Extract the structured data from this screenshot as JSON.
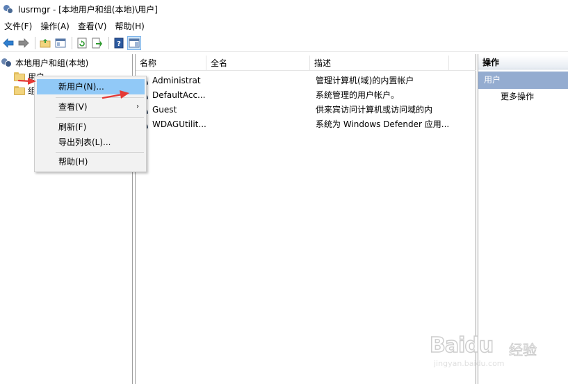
{
  "window": {
    "title": "lusrmgr - [本地用户和组(本地)\\用户]"
  },
  "menubar": {
    "items": [
      "文件(F)",
      "操作(A)",
      "查看(V)",
      "帮助(H)"
    ]
  },
  "toolbar": {
    "icons": [
      "back-arrow-icon",
      "forward-arrow-icon",
      "up-folder-icon",
      "show-hide-tree-icon",
      "refresh-icon",
      "export-list-icon",
      "help-icon",
      "show-hide-action-pane-icon"
    ]
  },
  "tree": {
    "root": "本地用户和组(本地)",
    "items": [
      "用户",
      "组"
    ]
  },
  "list": {
    "columns": [
      "名称",
      "全名",
      "描述"
    ],
    "rows": [
      {
        "name": "Administrat",
        "fullname": "",
        "desc": "管理计算机(域)的内置帐户"
      },
      {
        "name": "DefaultAcc...",
        "fullname": "",
        "desc": "系统管理的用户帐户。"
      },
      {
        "name": "Guest",
        "fullname": "",
        "desc": "供来宾访问计算机或访问域的内"
      },
      {
        "name": "WDAGUtilit...",
        "fullname": "",
        "desc": "系统为 Windows Defender 应用..."
      }
    ]
  },
  "actions": {
    "header": "操作",
    "section": "用户",
    "more": "更多操作"
  },
  "context_menu": {
    "items": [
      {
        "label": "新用户(N)...",
        "highlighted": true
      },
      {
        "label": "查看(V)",
        "submenu": true
      },
      {
        "label": "刷新(F)"
      },
      {
        "label": "导出列表(L)..."
      },
      {
        "label": "帮助(H)"
      }
    ],
    "submenu_glyph": "›"
  },
  "watermark": {
    "brand": "Baidu",
    "cn": "经验",
    "url": "jingyan.baidu.com"
  },
  "colors": {
    "highlight": "#91c9f7",
    "action_section": "#94acd0",
    "annotation_arrow": "#e53935"
  }
}
